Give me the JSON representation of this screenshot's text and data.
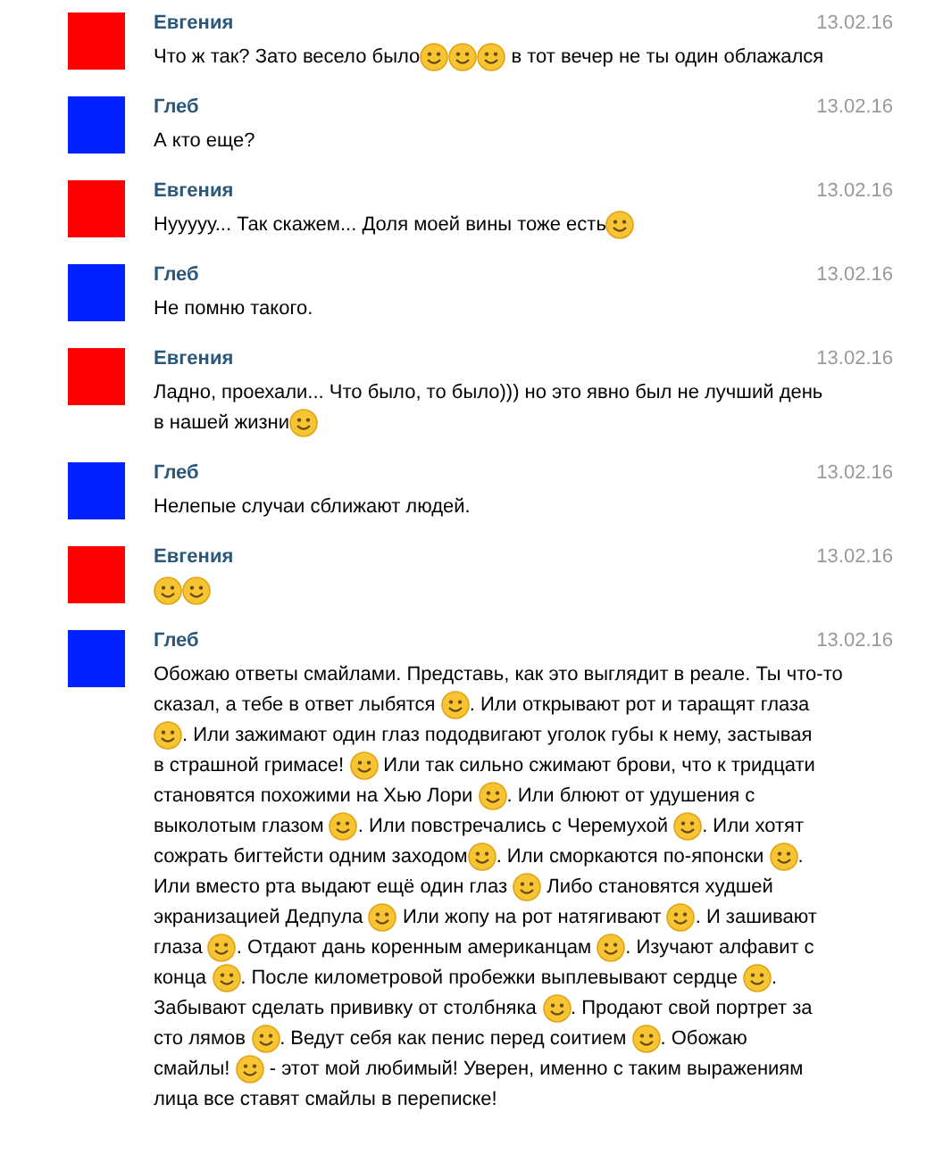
{
  "messages": [
    {
      "author": "Евгения",
      "color": "#ff0000",
      "date": "13.02.16",
      "segments": [
        {
          "kind": "text",
          "text": "Что ж так? Зато весело было"
        },
        {
          "kind": "emoji"
        },
        {
          "kind": "emoji"
        },
        {
          "kind": "emoji"
        },
        {
          "kind": "text",
          "text": " в тот вечер не ты один облажался"
        }
      ]
    },
    {
      "author": "Глеб",
      "color": "#0022ff",
      "date": "13.02.16",
      "segments": [
        {
          "kind": "text",
          "text": "А кто еще?"
        }
      ]
    },
    {
      "author": "Евгения",
      "color": "#ff0000",
      "date": "13.02.16",
      "segments": [
        {
          "kind": "text",
          "text": "Нууууу... Так скажем... Доля моей вины тоже есть"
        },
        {
          "kind": "emoji"
        }
      ]
    },
    {
      "author": "Глеб",
      "color": "#0022ff",
      "date": "13.02.16",
      "segments": [
        {
          "kind": "text",
          "text": "Не помню такого."
        }
      ]
    },
    {
      "author": "Евгения",
      "color": "#ff0000",
      "date": "13.02.16",
      "segments": [
        {
          "kind": "text",
          "text": "Ладно, проехали... Что было, то было))) но это явно был не лучший день в нашей жизни"
        },
        {
          "kind": "emoji"
        }
      ]
    },
    {
      "author": "Глеб",
      "color": "#0022ff",
      "date": "13.02.16",
      "segments": [
        {
          "kind": "text",
          "text": "Нелепые случаи сближают людей."
        }
      ]
    },
    {
      "author": "Евгения",
      "color": "#ff0000",
      "date": "13.02.16",
      "segments": [
        {
          "kind": "emoji"
        },
        {
          "kind": "emoji"
        }
      ]
    },
    {
      "author": "Глеб",
      "color": "#0022ff",
      "date": "13.02.16",
      "segments": [
        {
          "kind": "text",
          "text": "Обожаю ответы смайлами. Представь, как это выглядит в реале. Ты что-то сказал, а тебе в ответ лыбятся "
        },
        {
          "kind": "emoji"
        },
        {
          "kind": "text",
          "text": ". Или открывают рот и таращят глаза "
        },
        {
          "kind": "emoji"
        },
        {
          "kind": "text",
          "text": ". Или зажимают один глаз пододвигают уголок губы к нему, застывая в страшной гримасе! "
        },
        {
          "kind": "emoji"
        },
        {
          "kind": "text",
          "text": " Или так сильно сжимают брови, что к тридцати становятся похожими на Хью Лори "
        },
        {
          "kind": "emoji"
        },
        {
          "kind": "text",
          "text": ". Или блюют от удушения с выколотым глазом "
        },
        {
          "kind": "emoji"
        },
        {
          "kind": "text",
          "text": ". Или повстречались с Черемухой "
        },
        {
          "kind": "emoji"
        },
        {
          "kind": "text",
          "text": ". Или хотят сожрать бигтейсти одним заходом"
        },
        {
          "kind": "emoji"
        },
        {
          "kind": "text",
          "text": ". Или сморкаются по-японски "
        },
        {
          "kind": "emoji"
        },
        {
          "kind": "text",
          "text": ". Или вместо рта выдают ещё один глаз "
        },
        {
          "kind": "emoji"
        },
        {
          "kind": "text",
          "text": " Либо становятся худшей экранизацией Дедпула "
        },
        {
          "kind": "emoji"
        },
        {
          "kind": "text",
          "text": " Или жопу на рот натягивают "
        },
        {
          "kind": "emoji"
        },
        {
          "kind": "text",
          "text": ". И зашивают глаза "
        },
        {
          "kind": "emoji"
        },
        {
          "kind": "text",
          "text": ". Отдают дань коренным американцам "
        },
        {
          "kind": "emoji"
        },
        {
          "kind": "text",
          "text": ". Изучают алфавит с конца "
        },
        {
          "kind": "emoji"
        },
        {
          "kind": "text",
          "text": ". После километровой пробежки выплевывают сердце "
        },
        {
          "kind": "emoji"
        },
        {
          "kind": "text",
          "text": ". Забывают сделать прививку от столбняка "
        },
        {
          "kind": "emoji"
        },
        {
          "kind": "text",
          "text": ". Продают свой портрет за сто лямов "
        },
        {
          "kind": "emoji"
        },
        {
          "kind": "text",
          "text": ". Ведут себя как пенис перед соитием "
        },
        {
          "kind": "emoji"
        },
        {
          "kind": "text",
          "text": ". Обожаю смайлы! "
        },
        {
          "kind": "emoji"
        },
        {
          "kind": "text",
          "text": " - этот мой любимый! Уверен, именно с таким выражениям лица все ставят смайлы в переписке!"
        }
      ]
    }
  ]
}
